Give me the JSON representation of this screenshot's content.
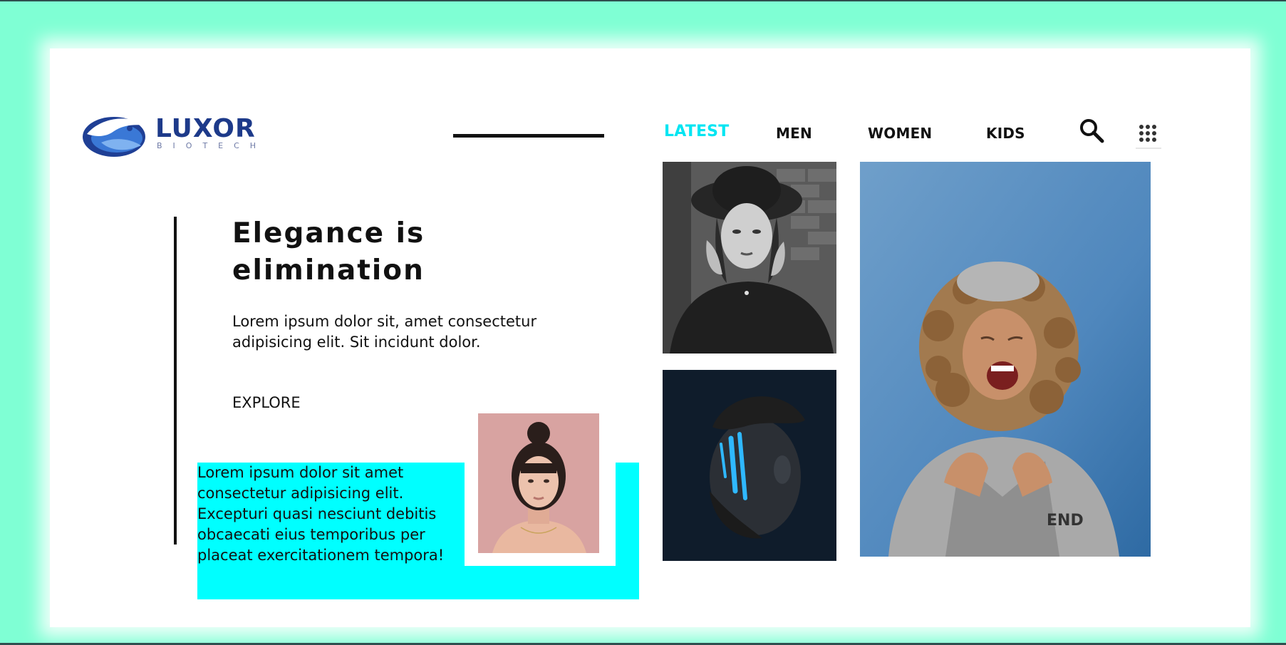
{
  "colors": {
    "frame": "#7fffd4",
    "accent": "#00e5f2",
    "feature_bg": "#00ffff",
    "brand": "#1d3a8a"
  },
  "brand": {
    "name": "LUXOR",
    "tagline": "BIOTECH"
  },
  "nav": {
    "items": [
      {
        "label": "LATEST",
        "active": true
      },
      {
        "label": "MEN",
        "active": false
      },
      {
        "label": "WOMEN",
        "active": false
      },
      {
        "label": "KIDS",
        "active": false
      }
    ],
    "icons": [
      "search-icon",
      "apps-grid-icon"
    ]
  },
  "hero": {
    "headline_line1": "Elegance is",
    "headline_line2": "elimination",
    "subtext": "Lorem ipsum dolor sit, amet consectetur adipisicing elit. Sit incidunt dolor.",
    "cta": "EXPLORE"
  },
  "feature": {
    "text": "Lorem ipsum dolor sit amet consectetur adipisicing elit. Excepturi quasi nesciunt debitis obcaecati eius temporibus per placeat exercitationem tempora!"
  },
  "photos": [
    {
      "name": "woman-pink-background-photo"
    },
    {
      "name": "woman-in-hat-bw-photo"
    },
    {
      "name": "man-blue-face-paint-photo"
    },
    {
      "name": "laughing-curly-hair-woman-photo"
    }
  ]
}
